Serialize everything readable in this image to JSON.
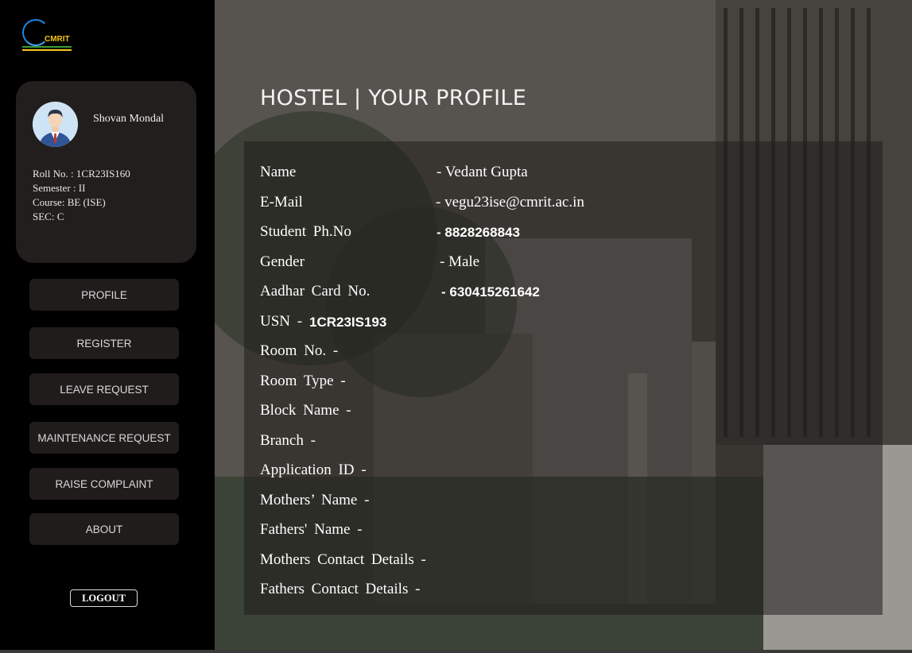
{
  "brand": {
    "logo_text": "CMRIT"
  },
  "sidebar": {
    "student_name": "Shovan Mondal",
    "roll_no": "Roll No. : 1CR23IS160",
    "semester": "Semester :  II",
    "course": "Course: BE (ISE)",
    "section": "SEC: C",
    "nav": [
      {
        "label": "PROFILE"
      },
      {
        "label": "REGISTER"
      },
      {
        "label": "LEAVE REQUEST"
      },
      {
        "label": "MAINTENANCE REQUEST"
      },
      {
        "label": "RAISE COMPLAINT"
      },
      {
        "label": "ABOUT"
      }
    ],
    "logout_label": "LOGOUT"
  },
  "main": {
    "title": "HOSTEL | YOUR PROFILE",
    "fields": [
      {
        "label": "Name",
        "value": "-  Vedant  Gupta"
      },
      {
        "label": "E-Mail",
        "value": "-  vegu23ise@cmrit.ac.in"
      },
      {
        "label": "Student  Ph.No",
        "value": "-  8828268843"
      },
      {
        "label": "Gender",
        "value": "-  Male"
      },
      {
        "label": "Aadhar  Card  No.",
        "value": "-  630415261642"
      },
      {
        "label": "USN  -",
        "value": "1CR23IS193"
      },
      {
        "label": "Room  No.  -",
        "value": ""
      },
      {
        "label": "Room  Type  -",
        "value": ""
      },
      {
        "label": "Block  Name  -",
        "value": ""
      },
      {
        "label": "Branch  -",
        "value": ""
      },
      {
        "label": "Application  ID  -",
        "value": ""
      },
      {
        "label": "Mothers’  Name  -",
        "value": ""
      },
      {
        "label": "Fathers'  Name  -",
        "value": ""
      },
      {
        "label": "Mothers  Contact  Details  -",
        "value": ""
      },
      {
        "label": "Fathers  Contact  Details  -",
        "value": ""
      }
    ]
  },
  "colors": {
    "sidebar_bg": "#000000",
    "card_bg": "#231e1e",
    "button_bg": "#211c1c",
    "text": "#ffffff"
  }
}
